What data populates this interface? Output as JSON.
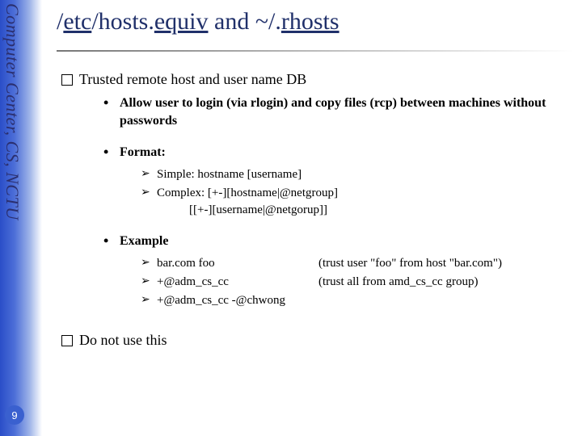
{
  "sidebar": {
    "text": "Computer Center, CS, NCTU",
    "page_number": "9"
  },
  "title": {
    "part1": "/",
    "part2": "etc",
    "part3": "/hosts.",
    "part4": "equiv",
    "part5": " and ~/.",
    "part6": "rhosts"
  },
  "bullets": {
    "b1": "Trusted remote host and user name DB",
    "b1_1": "Allow user to login (via rlogin) and copy files (rcp) between machines without passwords",
    "b1_2": "Format:",
    "b1_2_1": "Simple: hostname [username]",
    "b1_2_2": "Complex: [+-][hostname|@netgroup]",
    "b1_2_2b": "[[+-][username|@netgorup]]",
    "b1_3": "Example",
    "b1_3_1l": "bar.com foo",
    "b1_3_1r": "(trust user \"foo\" from host \"bar.com\")",
    "b1_3_2l": "+@adm_cs_cc",
    "b1_3_2r": "(trust all from amd_cs_cc group)",
    "b1_3_3l": "+@adm_cs_cc -@chwong",
    "b2": "Do not use this"
  }
}
